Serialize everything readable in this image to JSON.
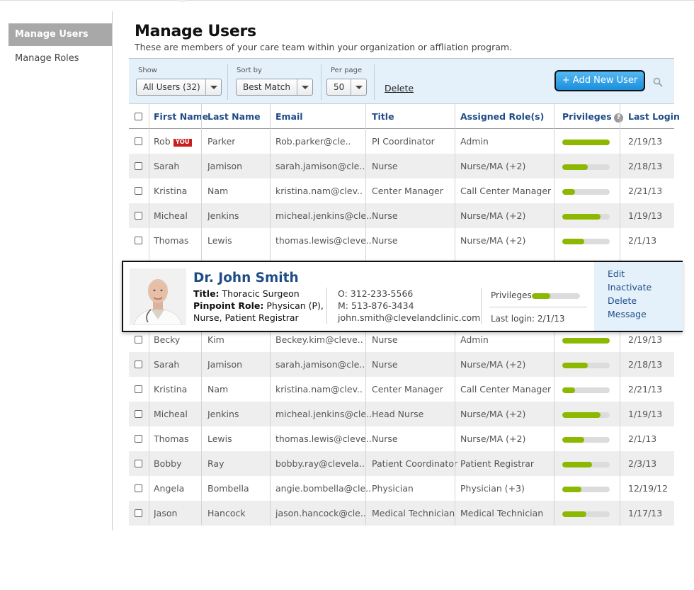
{
  "sidebar": {
    "items": [
      {
        "label": "Manage Users"
      },
      {
        "label": "Manage Roles"
      }
    ]
  },
  "header": {
    "title": "Manage Users",
    "subtitle": "These are members of your care team within your organization or affliation program."
  },
  "toolbar": {
    "show_label": "Show",
    "show_value": "All Users (32)",
    "sort_label": "Sort by",
    "sort_value": "Best Match",
    "perpage_label": "Per page",
    "perpage_value": "50",
    "delete_label": "Delete",
    "add_label": "+ Add New User",
    "search_icon": "search-icon"
  },
  "table": {
    "columns": [
      "First Name",
      "Last Name",
      "Email",
      "Title",
      "Assigned Role(s)",
      "Privileges",
      "Last Login"
    ],
    "you_badge": "YOU",
    "rows_top": [
      {
        "first": "Rob",
        "last": "Parker",
        "email": "Rob.parker@cle..",
        "title": "PI Coordinator",
        "role": "Admin",
        "priv": 1.0,
        "login": "2/19/13",
        "you": true
      },
      {
        "first": "Sarah",
        "last": "Jamison",
        "email": "sarah.jamison@cle..",
        "title": "Nurse",
        "role": "Nurse/MA  (+2)",
        "priv": 0.53,
        "login": "2/18/13"
      },
      {
        "first": "Kristina",
        "last": "Nam",
        "email": "kristina.nam@clev..",
        "title": "Center Manager",
        "role": "Call Center Manager",
        "priv": 0.27,
        "login": "2/21/13"
      },
      {
        "first": "Micheal",
        "last": "Jenkins",
        "email": "micheal.jenkins@cle..",
        "title": "Nurse",
        "role": "Nurse/MA (+2)",
        "priv": 0.8,
        "login": "1/19/13"
      },
      {
        "first": "Thomas",
        "last": "Lewis",
        "email": "thomas.lewis@cleve..",
        "title": "Nurse",
        "role": "Nurse/MA (+2)",
        "priv": 0.47,
        "login": "2/1/13"
      }
    ],
    "rows_bottom": [
      {
        "first": "Becky",
        "last": "Kim",
        "email": "Beckey.kim@cleve..",
        "title": "Nurse",
        "role": "Admin",
        "priv": 1.0,
        "login": "2/19/13"
      },
      {
        "first": "Sarah",
        "last": "Jamison",
        "email": "sarah.jamison@cle..",
        "title": "Nurse",
        "role": "Nurse/MA (+2)",
        "priv": 0.53,
        "login": "2/18/13"
      },
      {
        "first": "Kristina",
        "last": "Nam",
        "email": "kristina.nam@clev..",
        "title": "Center Manager",
        "role": "Call Center Manager",
        "priv": 0.27,
        "login": "2/21/13"
      },
      {
        "first": "Micheal",
        "last": "Jenkins",
        "email": "micheal.jenkins@cle..",
        "title": "Head Nurse",
        "role": "Nurse/MA (+2)",
        "priv": 0.8,
        "login": "1/19/13"
      },
      {
        "first": "Thomas",
        "last": "Lewis",
        "email": "thomas.lewis@cleve..",
        "title": "Nurse",
        "role": "Nurse/MA (+2)",
        "priv": 0.47,
        "login": "2/1/13"
      },
      {
        "first": "Bobby",
        "last": "Ray",
        "email": "bobby.ray@clevela..",
        "title": "Patient Coordinator",
        "role": "Patient Registrar",
        "priv": 0.63,
        "login": "2/3/13"
      },
      {
        "first": "Angela",
        "last": "Bombella",
        "email": "angie.bombella@cle..",
        "title": "Physician",
        "role": "Physician  (+3)",
        "priv": 0.4,
        "login": "12/19/12"
      },
      {
        "first": "Jason",
        "last": "Hancock",
        "email": "jason.hancock@cle..",
        "title": "Medical Technician",
        "role": "Medical Technician",
        "priv": 0.5,
        "login": "1/17/13"
      }
    ]
  },
  "profile_card": {
    "name": "Dr. John Smith",
    "title_label": "Title:",
    "title_value": "Thoracic Surgeon",
    "role_label": "Pinpoint Role:",
    "role_value_1": "Physican (P),",
    "role_value_2": "Nurse, Patient Registrar",
    "office": "O: 312-233-5566",
    "mobile": "M: 513-876-3434",
    "email": "john.smith@clevelandclinic.com",
    "privileges_label": "Privileges",
    "privileges": 0.38,
    "last_login": "Last login: 2/1/13",
    "actions": [
      "Edit",
      "Inactivate",
      "Delete",
      "Message"
    ]
  },
  "colors": {
    "accent_blue": "#1f4c87",
    "toolbar_bg": "#e4f1fb",
    "privilege_green": "#8cb800",
    "you_badge_red": "#c81e1e",
    "add_button": "#1a8fdc"
  }
}
